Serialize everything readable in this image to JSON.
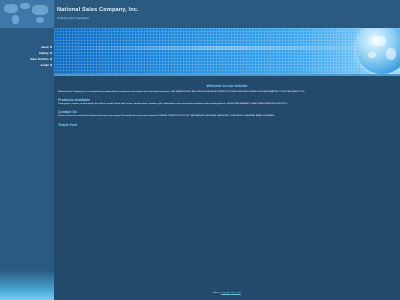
{
  "site": {
    "title": "National Sales Company, Inc.",
    "tagline": "Global Import Specialist"
  },
  "nav": {
    "items": [
      {
        "label": "About"
      },
      {
        "label": "Catalog"
      },
      {
        "label": "Sales Portfolio"
      },
      {
        "label": "E-mail"
      }
    ]
  },
  "main": {
    "welcome": "Welcome to our website",
    "intro": "National Sales Company, Inc. is committed to providing both it's customers and vendors with up to date information. OUR WEBSITE WILL BE DOWN FOR A SHORT PERIOD OF TIME WHILE WE UPDATE OUR INFORMATION TO BETTER SERVE YOU.",
    "products_title": "Products Available",
    "products_text": "Trade paper, coupons, printed goods, bic stickers, novelty, Items with charms, Impulse items, sneakers, gifts, adornments, shoe accessories and many other novelty products. FROM ONE MEMBER TO ANOTHER WEBSITE PRODUCTS.",
    "contact_title": "Contact Us",
    "contact_text": "Please click on the e-mail button above and send us your inquiry. We would love to earn your business! DURING CONSTRUCTION OF THE WEBSITE, NATIONAL SALES WILL CONTINUE TO ANSWER EMAIL INQUIRIES.",
    "thanks": "Thank You!"
  },
  "footer": {
    "prefix": "Admin |",
    "copyright": "Copyright",
    "link": "Site Login"
  },
  "colors": {
    "background": "#234a6b",
    "heading": "#7fd0ff",
    "banner": "#1a86dc"
  }
}
